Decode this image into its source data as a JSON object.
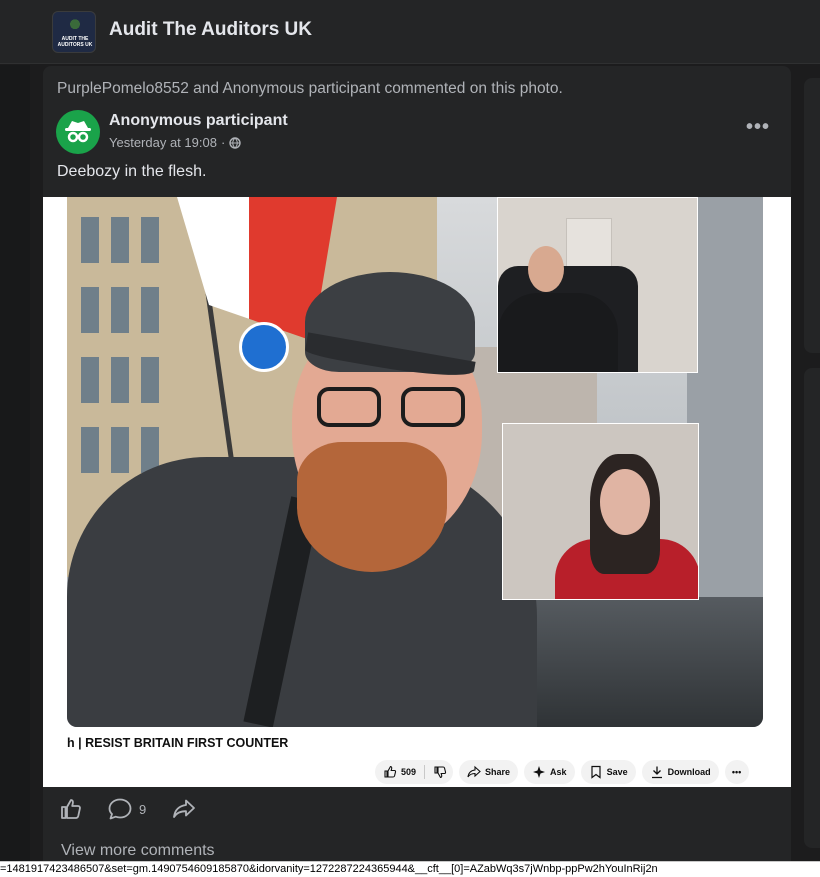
{
  "group": {
    "name": "Audit The Auditors UK",
    "logo_text": "AUDIT THE AUDITORS UK"
  },
  "post": {
    "activity": "PurplePomelo8552 and Anonymous participant commented on this photo.",
    "author": "Anonymous participant",
    "time": "Yesterday at 19:08",
    "separator": "·",
    "privacy_icon": "globe-icon",
    "caption": "Deebozy in the flesh.",
    "more_label": "•••"
  },
  "photo": {
    "video_title": "h | RESIST BRITAIN FIRST COUNTER",
    "like_count": "509",
    "share_label": "Share",
    "ask_label": "Ask",
    "save_label": "Save",
    "download_label": "Download",
    "more_label": "•••"
  },
  "actions": {
    "like_icon": "thumbs-up-icon",
    "comment_icon": "comment-icon",
    "comment_count": "9",
    "share_icon": "share-arrow-icon"
  },
  "comments": {
    "view_more": "View more comments"
  },
  "status_bar": {
    "url": "=1481917423486507&set=gm.1490754609185870&idorvanity=1272287224365944&__cft__[0]=AZabWq3s7jWnbp-ppPw2hYouInRij2n"
  },
  "colors": {
    "background": "#1c1c1d",
    "card": "#242526",
    "text_primary": "#e4e6eb",
    "text_secondary": "#b0b3b8",
    "avatar_green": "#1aa34a"
  }
}
